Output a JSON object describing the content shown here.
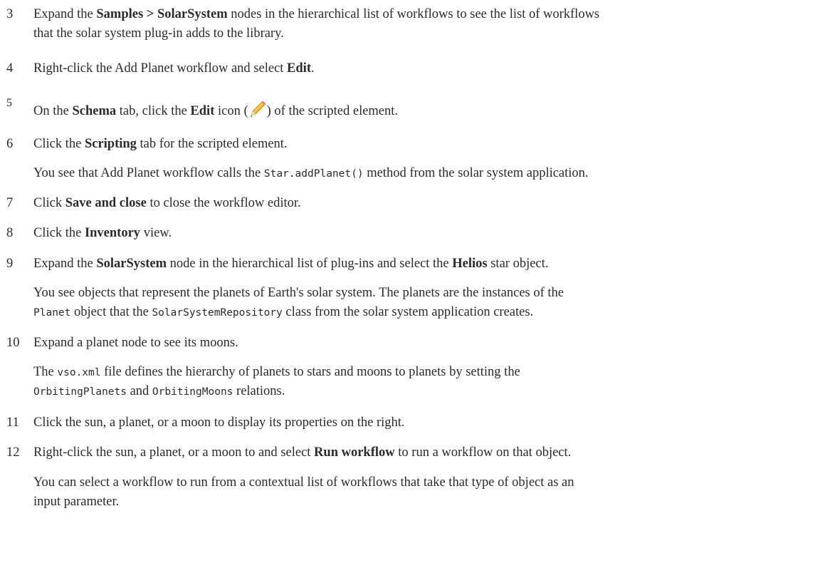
{
  "steps": [
    {
      "num": "3",
      "t1": "Expand the ",
      "b1": "Samples > SolarSystem",
      "t2": " nodes in the hierarchical list of workflows to see the list of workflows",
      "line2": "that the solar system plug-in adds to the library."
    },
    {
      "num": "4",
      "t1": "Right-click the Add Planet workflow and select ",
      "b1": "Edit",
      "t2": "."
    },
    {
      "num": "5",
      "t1": "On the ",
      "b1": "Schema",
      "t2": " tab, click the ",
      "b2": "Edit",
      "t3": " icon (",
      "t4": ") of the scripted element.",
      "icon": "pencil-icon"
    },
    {
      "num": "6",
      "t1": "Click the ",
      "b1": "Scripting",
      "t2": " tab for the scripted element.",
      "note_t1": "You see that Add Planet workflow calls the ",
      "note_code1": "Star.addPlanet()",
      "note_t2": " method from the solar system application."
    },
    {
      "num": "7",
      "t1": "Click ",
      "b1": "Save and close",
      "t2": " to close the workflow editor."
    },
    {
      "num": "8",
      "t1": "Click the ",
      "b1": "Inventory",
      "t2": " view."
    },
    {
      "num": "9",
      "t1": "Expand the ",
      "b1": "SolarSystem",
      "t2": " node in the hierarchical list of plug-ins and select the ",
      "b2": "Helios",
      "t3": " star object.",
      "note_line1": "You see objects that represent the planets of Earth's solar system. The planets are the instances of the",
      "note_code1": "Planet",
      "note_t1": " object that the ",
      "note_code2": "SolarSystemRepository",
      "note_t2": " class from the solar system application creates."
    },
    {
      "num": "10",
      "t1": "Expand a planet node to see its moons.",
      "note_t1": "The ",
      "note_code1": "vso.xml",
      "note_t2": " file defines the hierarchy of planets to stars and moons to planets by setting the",
      "note_code2": "OrbitingPlanets",
      "note_t3": " and ",
      "note_code3": "OrbitingMoons",
      "note_t4": " relations."
    },
    {
      "num": "11",
      "t1": "Click the sun, a planet, or a moon to display its properties on the right."
    },
    {
      "num": "12",
      "t1": "Right-click the sun, a planet, or a moon to and select ",
      "b1": "Run workflow",
      "t2": " to run a workflow on that object.",
      "note_line1": "You can select a workflow to run from a contextual list of workflows that take that type of object as an",
      "note_line2": "input parameter."
    }
  ]
}
